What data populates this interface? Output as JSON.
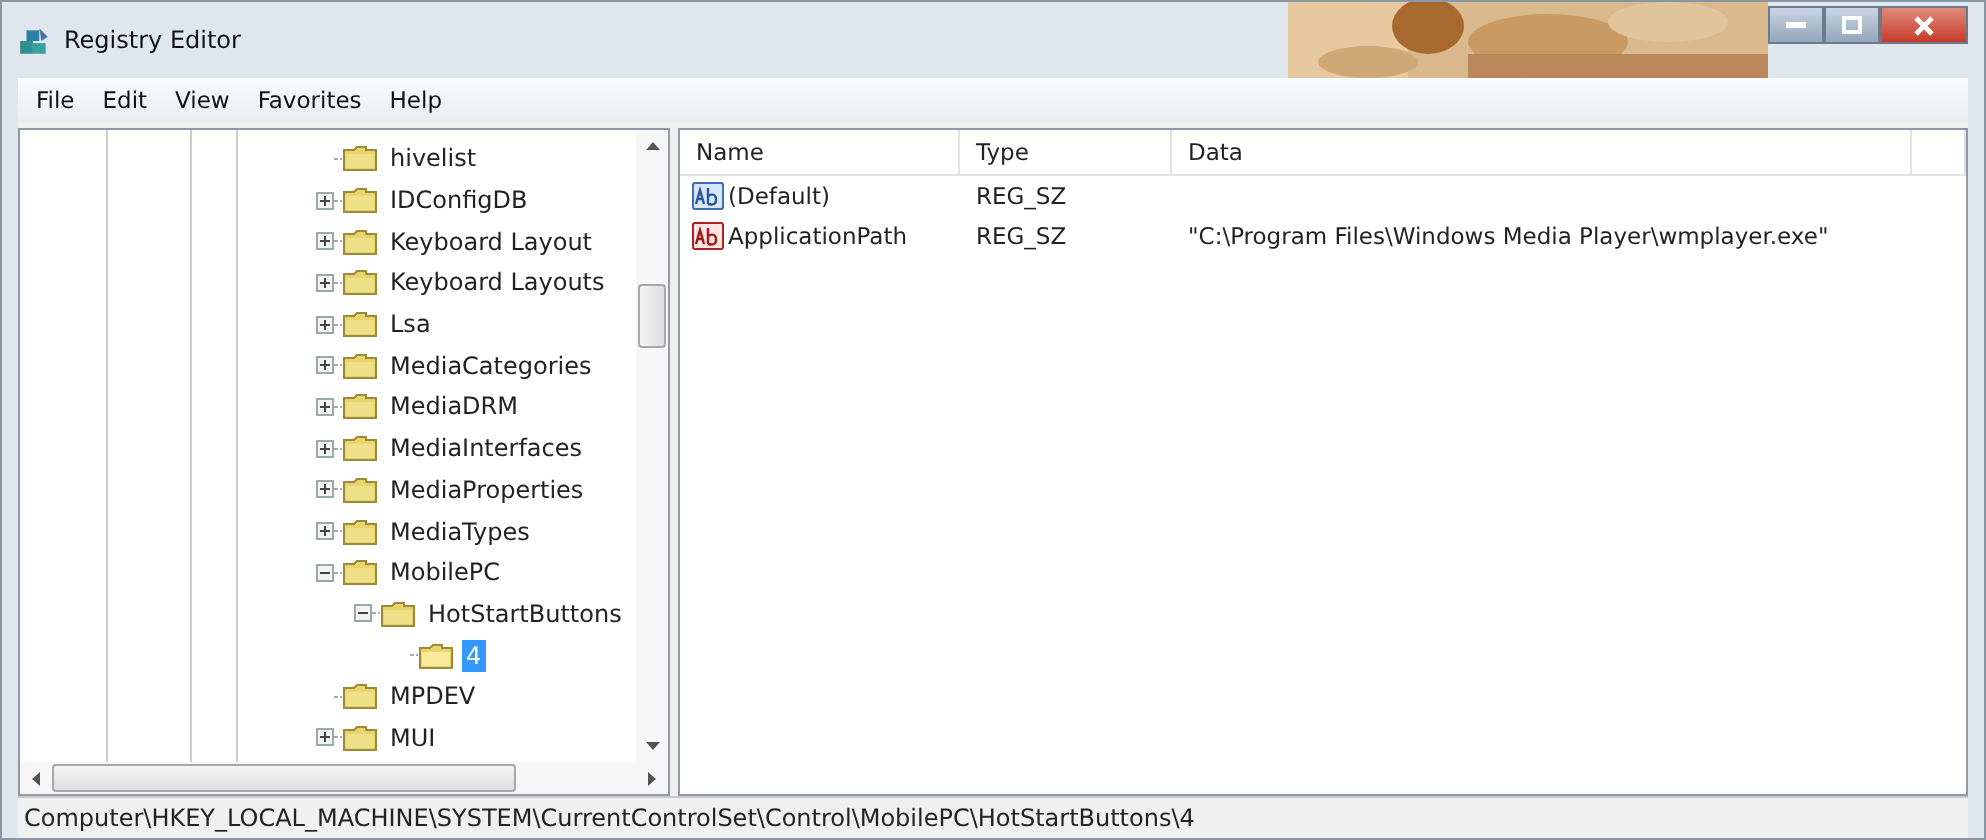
{
  "window": {
    "title": "Registry Editor"
  },
  "menu": [
    "File",
    "Edit",
    "View",
    "Favorites",
    "Help"
  ],
  "tree": [
    {
      "label": "hivelist",
      "kind": "leaf",
      "selected": false
    },
    {
      "label": "IDConfigDB",
      "kind": "collapsed",
      "selected": false
    },
    {
      "label": "Keyboard Layout",
      "kind": "collapsed",
      "selected": false
    },
    {
      "label": "Keyboard Layouts",
      "kind": "collapsed",
      "selected": false
    },
    {
      "label": "Lsa",
      "kind": "collapsed",
      "selected": false
    },
    {
      "label": "MediaCategories",
      "kind": "collapsed",
      "selected": false
    },
    {
      "label": "MediaDRM",
      "kind": "collapsed",
      "selected": false
    },
    {
      "label": "MediaInterfaces",
      "kind": "collapsed",
      "selected": false
    },
    {
      "label": "MediaProperties",
      "kind": "collapsed",
      "selected": false
    },
    {
      "label": "MediaTypes",
      "kind": "collapsed",
      "selected": false
    },
    {
      "label": "MobilePC",
      "kind": "expanded",
      "selected": false,
      "children": [
        {
          "label": "HotStartButtons",
          "kind": "expanded",
          "selected": false,
          "children": [
            {
              "label": "4",
              "kind": "leaf",
              "selected": true
            }
          ]
        }
      ]
    },
    {
      "label": "MPDEV",
      "kind": "leaf",
      "selected": false
    },
    {
      "label": "MUI",
      "kind": "collapsed",
      "selected": false
    }
  ],
  "table": {
    "columns": [
      "Name",
      "Type",
      "Data"
    ],
    "rows": [
      {
        "name": "(Default)",
        "type": "REG_SZ",
        "data": "",
        "kind": "default"
      },
      {
        "name": "ApplicationPath",
        "type": "REG_SZ",
        "data": "\"C:\\Program Files\\Windows Media Player\\wmplayer.exe\"",
        "kind": "string"
      }
    ]
  },
  "status_bar": "Computer\\HKEY_LOCAL_MACHINE\\SYSTEM\\CurrentControlSet\\Control\\MobilePC\\HotStartButtons\\4"
}
